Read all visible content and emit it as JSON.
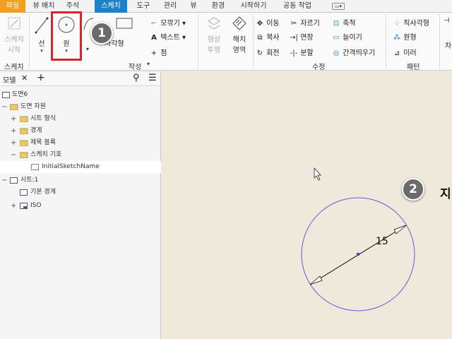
{
  "menu_tabs": [
    "파일",
    "뷰 배치",
    "주석",
    "스케치",
    "도구",
    "관리",
    "뷰",
    "환경",
    "시작하기",
    "공동 작업"
  ],
  "ribbon": {
    "sketch_start": {
      "label1": "스케치",
      "label2": "시작"
    },
    "line": "선",
    "circle": "원",
    "rectangle": "사각형",
    "fillet": "모깎기",
    "text": "텍스트",
    "point": "점",
    "project": {
      "label1": "형상",
      "label2": "투영"
    },
    "hatch": {
      "label1": "해치",
      "label2": "영역"
    },
    "move": "이동",
    "copy": "복사",
    "rotate": "회전",
    "trim": "자르기",
    "extend": "연장",
    "split": "분할",
    "scale": "축척",
    "stretch": "늘이기",
    "offset": "간격띄우기",
    "rect_pattern": "직사각형",
    "circ_pattern": "원형",
    "mirror": "미러",
    "groups": {
      "sketch": "스케치",
      "create": "작성",
      "modify": "수정",
      "pattern": "패턴"
    },
    "cut_text": "차"
  },
  "panel": {
    "tab": "모델",
    "tree": [
      {
        "label": "도면6"
      },
      {
        "label": "도면 자원"
      },
      {
        "label": "시트 형식"
      },
      {
        "label": "경계"
      },
      {
        "label": "제목 블록"
      },
      {
        "label": "스케치 기호"
      },
      {
        "label": "InitialSketchName"
      },
      {
        "label": "시트:1"
      },
      {
        "label": "기본 경계"
      },
      {
        "label": "ISO"
      }
    ]
  },
  "canvas": {
    "dimension_value": "15",
    "partial_text": "지"
  },
  "callouts": [
    "1",
    "2"
  ]
}
